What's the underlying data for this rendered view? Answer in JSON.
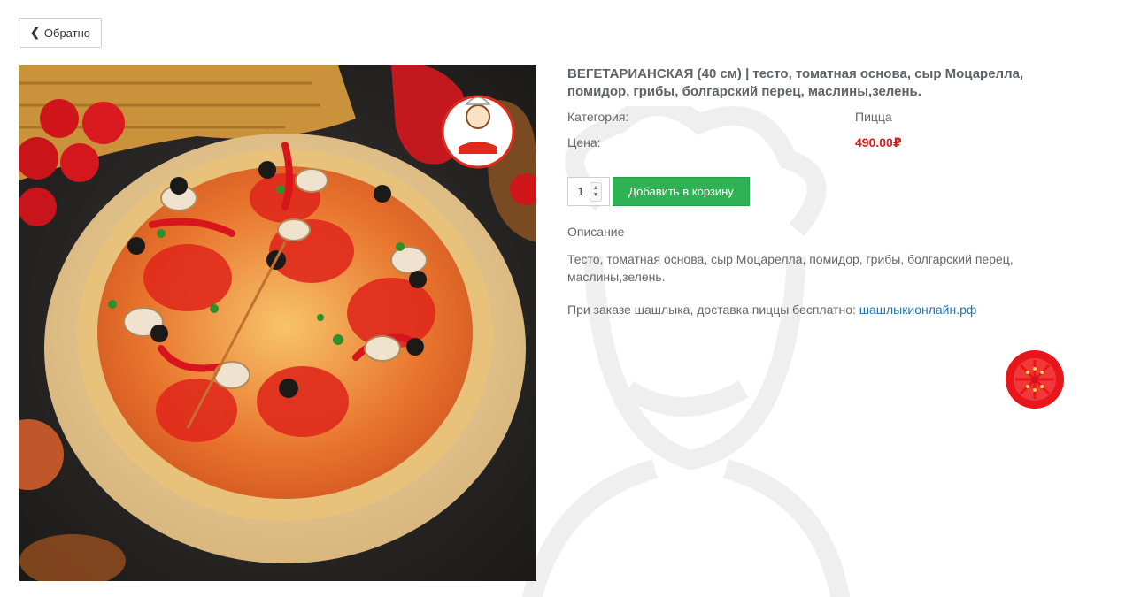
{
  "nav": {
    "back_label": "Обратно",
    "back_icon": "chevron-left-icon"
  },
  "product": {
    "title": "ВЕГЕТАРИАНСКАЯ (40 см) | тесто, томатная основа, сыр Моцарелла, помидор, грибы, болгарский перец, маслины,зелень.",
    "category_label": "Категория:",
    "category_value": "Пицца",
    "price_label": "Цена:",
    "price_value": "490.00₽",
    "price_color": "#e3171b"
  },
  "cart": {
    "quantity": "1",
    "add_label": "Добавить в корзину",
    "add_color": "#2eb254"
  },
  "description": {
    "heading": "Описание",
    "text": "Тесто, томатная основа, сыр Моцарелла, помидор, грибы, болгарский перец, маслины,зелень."
  },
  "promo": {
    "text": "При заказе шашлыка, доставка пиццы бесплатно: ",
    "link_label": "шашлыкионлайн.рф",
    "link_color": "#1d74b6"
  },
  "floating_button": {
    "icon": "tomato-icon"
  }
}
